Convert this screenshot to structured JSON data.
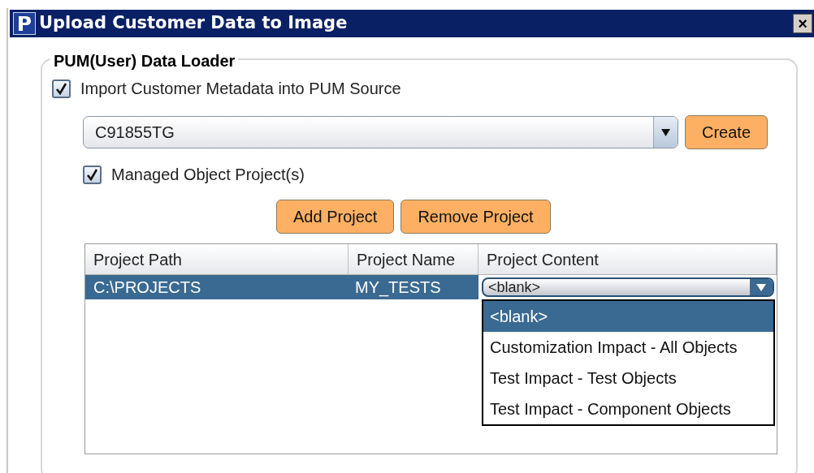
{
  "window": {
    "title": "Upload Customer Data to Image",
    "close": "×"
  },
  "group": {
    "title": "PUM(User) Data Loader"
  },
  "import_checkbox": {
    "label": "Import Customer Metadata into PUM Source",
    "checked": true
  },
  "source_combo": {
    "value": "C91855TG"
  },
  "create_button": "Create",
  "managed_checkbox": {
    "label": "Managed Object Project(s)",
    "checked": true
  },
  "buttons": [
    "Add Project",
    "Remove Project"
  ],
  "table": {
    "columns": [
      "Project Path",
      "Project Name",
      "Project Content"
    ],
    "rows": [
      {
        "cells": [
          "C:\\PROJECTS",
          "MY_TESTS",
          "<blank>"
        ],
        "selected": true
      }
    ]
  },
  "dropdown": {
    "options": [
      {
        "label": "<blank>",
        "selected": true
      },
      {
        "label": "Customization Impact - All Objects",
        "selected": false
      },
      {
        "label": "Test Impact - Test Objects",
        "selected": false
      },
      {
        "label": "Test Impact - Component Objects",
        "selected": false
      }
    ]
  }
}
